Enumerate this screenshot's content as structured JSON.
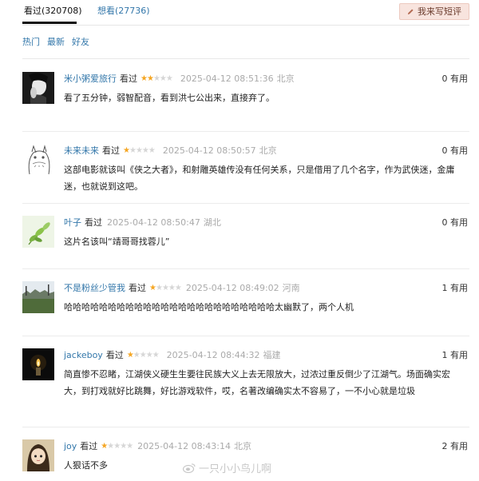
{
  "tabs": [
    {
      "label": "看过(320708)",
      "active": true
    },
    {
      "label": "想看(27736)",
      "active": false
    }
  ],
  "write_button": {
    "label": "我来写短评"
  },
  "sort_tabs": [
    "热门",
    "最新",
    "好友"
  ],
  "reviews": [
    {
      "user": "米小粥爱旅行",
      "status": "看过",
      "rating": 2,
      "time": "2025-04-12 08:51:36",
      "location": "北京",
      "useful": "0 有用",
      "content": "看了五分钟，弱智配音，看到洪七公出来，直接弃了。",
      "avatar": "avatar-dark-face"
    },
    {
      "user": "未来未来",
      "status": "看过",
      "rating": 1,
      "time": "2025-04-12 08:50:57",
      "location": "北京",
      "useful": "0 有用",
      "content": "这部电影就该叫《侠之大者》，和射雕英雄传没有任何关系，只是借用了几个名字，作为武侠迷，金庸迷，也就说到这吧。",
      "avatar": "avatar-totoro-sketch"
    },
    {
      "user": "叶子",
      "status": "看过",
      "rating": 0,
      "time": "2025-04-12 08:50:47",
      "location": "湖北",
      "useful": "0 有用",
      "content": "这片名该叫“靖哥哥找蓉儿”",
      "avatar": "avatar-green-leaves"
    },
    {
      "user": "不是粉丝少管我",
      "status": "看过",
      "rating": 1,
      "time": "2025-04-12 08:49:02",
      "location": "河南",
      "useful": "1 有用",
      "content": "哈哈哈哈哈哈哈哈哈哈哈哈哈哈哈哈哈哈哈哈哈哈哈哈太幽默了，两个人机",
      "avatar": "avatar-landscape"
    },
    {
      "user": "jackeboy",
      "status": "看过",
      "rating": 1,
      "time": "2025-04-12 08:44:32",
      "location": "福建",
      "useful": "1 有用",
      "content": "简直惨不忍睹，江湖侠义硬生生要往民族大义上去无限放大，过浓过重反倒少了江湖气。场面确实宏大，到打戏就好比跳舞，好比游戏软件，哎，名著改编确实太不容易了，一不小心就是垃圾",
      "avatar": "avatar-candle-dark"
    },
    {
      "user": "joy",
      "status": "看过",
      "rating": 1,
      "time": "2025-04-12 08:43:14",
      "location": "北京",
      "useful": "2 有用",
      "content": "人狠话不多",
      "avatar": "avatar-anime-girl"
    }
  ],
  "watermark": "一只小小鸟儿啊",
  "colors": {
    "link": "#3377aa",
    "star": "#f5a623",
    "button_bg": "#f8e4de"
  }
}
